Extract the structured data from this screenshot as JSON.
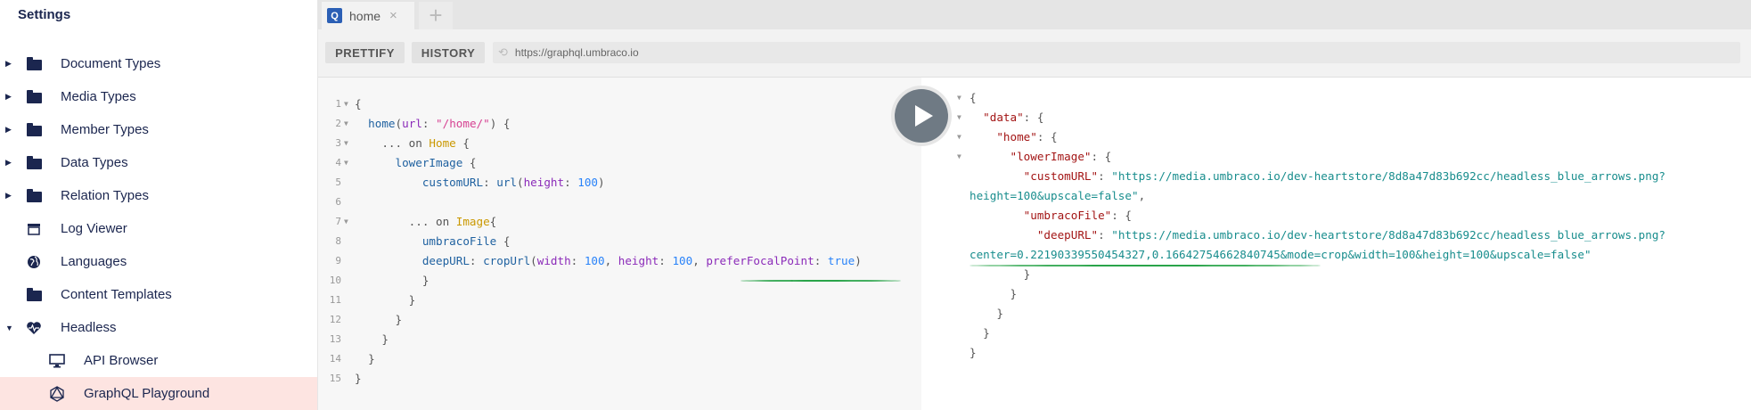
{
  "sidebar": {
    "title": "Settings",
    "items": [
      {
        "label": "Document Types",
        "icon": "folder-icon"
      },
      {
        "label": "Media Types",
        "icon": "folder-icon"
      },
      {
        "label": "Member Types",
        "icon": "folder-icon"
      },
      {
        "label": "Data Types",
        "icon": "folder-icon"
      },
      {
        "label": "Relation Types",
        "icon": "folder-icon"
      },
      {
        "label": "Log Viewer",
        "icon": "log-icon"
      },
      {
        "label": "Languages",
        "icon": "globe-icon"
      },
      {
        "label": "Content Templates",
        "icon": "folder-icon"
      },
      {
        "label": "Headless",
        "icon": "heart-icon"
      },
      {
        "label": "API Browser",
        "icon": "monitor-icon"
      },
      {
        "label": "GraphQL Playground",
        "icon": "graphql-icon"
      }
    ]
  },
  "tabs": {
    "home_label": "home",
    "badge": "Q",
    "close_glyph": "×",
    "add_glyph": "+"
  },
  "toolbar": {
    "prettify_label": "PRETTIFY",
    "history_label": "HISTORY",
    "url": "https://graphql.umbraco.io"
  },
  "query_lines": [
    "1",
    "2",
    "3",
    "4",
    "5",
    "6",
    "7",
    "8",
    "9",
    "10",
    "11",
    "12",
    "13",
    "14",
    "15"
  ],
  "accent_colors": {
    "underline": "#2aa44a",
    "active_item_bg": "#fde4e1"
  }
}
